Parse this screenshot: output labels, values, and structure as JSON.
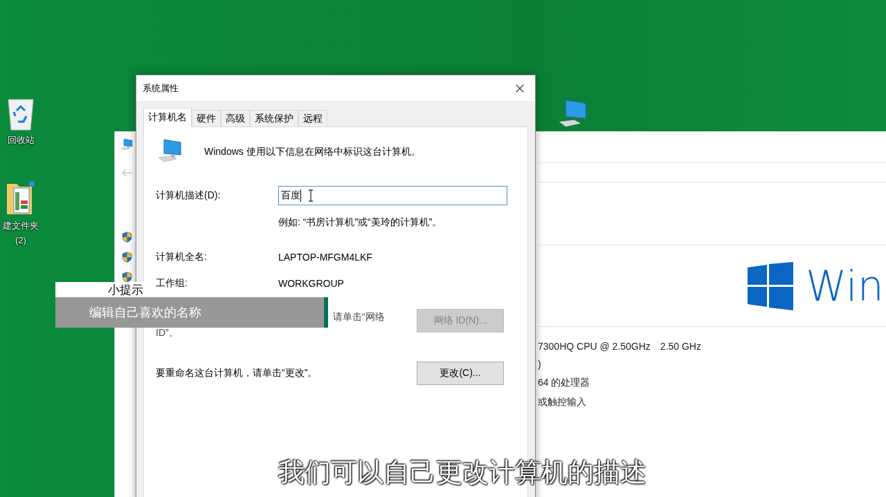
{
  "desktop_icons": [
    {
      "kind": "recycle",
      "label": "回收站"
    },
    {
      "kind": "folder",
      "label": "建文件夹",
      "sublabel": "(2)"
    }
  ],
  "back_window": {
    "logo_text": "Win",
    "spec_lines": [
      [
        "7300HQ CPU @ 2.50GHz",
        "2.50 GHz"
      ],
      [
        ")"
      ],
      [
        "64 的处理器"
      ],
      [
        "或触控输入"
      ]
    ]
  },
  "dialog": {
    "title": "系统属性",
    "tabs": [
      {
        "label": "计算机名",
        "selected": true
      },
      {
        "label": "硬件",
        "selected": false
      },
      {
        "label": "高级",
        "selected": false
      },
      {
        "label": "系统保护",
        "selected": false
      },
      {
        "label": "远程",
        "selected": false
      }
    ],
    "intro": "Windows 使用以下信息在网络中标识这台计算机。",
    "description": {
      "label": "计算机描述(D):",
      "value": "百度"
    },
    "hint": "例如: “书房计算机”或“美玲的计算机”。",
    "full_name": {
      "label": "计算机全名:",
      "value": "LAPTOP-MFGM4LKF"
    },
    "workgroup": {
      "label": "工作组:",
      "value": "WORKGROUP"
    },
    "network_text": [
      "请单击“网络",
      "ID”。"
    ],
    "network_button": {
      "label": "网络 ID(N)...",
      "disabled": true
    },
    "rename_text": "要重命名这台计算机，请单击“更改”。",
    "change_button": {
      "label": "更改(C)...",
      "disabled": false
    }
  },
  "tip": {
    "title": "小提示",
    "text": "编辑自己喜欢的名称"
  },
  "subtitle": "我们可以自己更改计算机的描述"
}
